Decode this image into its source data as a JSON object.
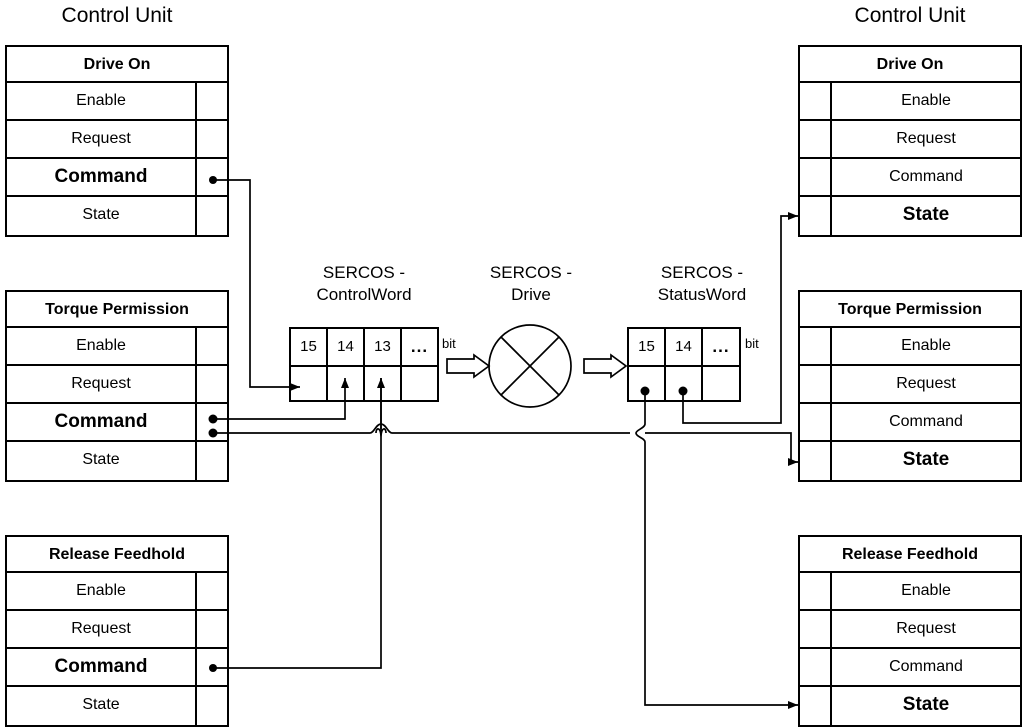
{
  "diagram": {
    "title_left": "Control Unit",
    "title_right": "Control Unit",
    "bit_label": "bit"
  },
  "left_units": [
    {
      "id": "drive-on-left",
      "header": "Drive On",
      "rows": [
        {
          "label": "Enable",
          "bold": false,
          "port": false
        },
        {
          "label": "Request",
          "bold": false,
          "port": false
        },
        {
          "label": "Command",
          "bold": true,
          "port": true
        },
        {
          "label": "State",
          "bold": false,
          "port": false
        }
      ]
    },
    {
      "id": "torque-permission-left",
      "header": "Torque Permission",
      "rows": [
        {
          "label": "Enable",
          "bold": false,
          "port": false
        },
        {
          "label": "Request",
          "bold": false,
          "port": false
        },
        {
          "label": "Command",
          "bold": true,
          "port": true
        },
        {
          "label": "State",
          "bold": false,
          "port": false
        }
      ]
    },
    {
      "id": "release-feedhold-left",
      "header": "Release Feedhold",
      "rows": [
        {
          "label": "Enable",
          "bold": false,
          "port": false
        },
        {
          "label": "Request",
          "bold": false,
          "port": false
        },
        {
          "label": "Command",
          "bold": true,
          "port": true
        },
        {
          "label": "State",
          "bold": false,
          "port": false
        }
      ]
    }
  ],
  "right_units": [
    {
      "id": "drive-on-right",
      "header": "Drive On",
      "rows": [
        {
          "label": "Enable",
          "bold": false,
          "port": false
        },
        {
          "label": "Request",
          "bold": false,
          "port": false
        },
        {
          "label": "Command",
          "bold": false,
          "port": false
        },
        {
          "label": "State",
          "bold": true,
          "port": true
        }
      ]
    },
    {
      "id": "torque-permission-right",
      "header": "Torque Permission",
      "rows": [
        {
          "label": "Enable",
          "bold": false,
          "port": false
        },
        {
          "label": "Request",
          "bold": false,
          "port": false
        },
        {
          "label": "Command",
          "bold": false,
          "port": false
        },
        {
          "label": "State",
          "bold": true,
          "port": true
        }
      ]
    },
    {
      "id": "release-feedhold-right",
      "header": "Release Feedhold",
      "rows": [
        {
          "label": "Enable",
          "bold": false,
          "port": false
        },
        {
          "label": "Request",
          "bold": false,
          "port": false
        },
        {
          "label": "Command",
          "bold": false,
          "port": false
        },
        {
          "label": "State",
          "bold": true,
          "port": true
        }
      ]
    }
  ],
  "control_word": {
    "title": "SERCOS -\nControlWord",
    "bits": [
      "15",
      "14",
      "13",
      "..."
    ]
  },
  "status_word": {
    "title": "SERCOS -\nStatusWord",
    "bits": [
      "15",
      "14",
      "..."
    ]
  },
  "drive": {
    "title": "SERCOS -\nDrive"
  },
  "colors": {
    "line": "#000000",
    "background": "#ffffff"
  }
}
